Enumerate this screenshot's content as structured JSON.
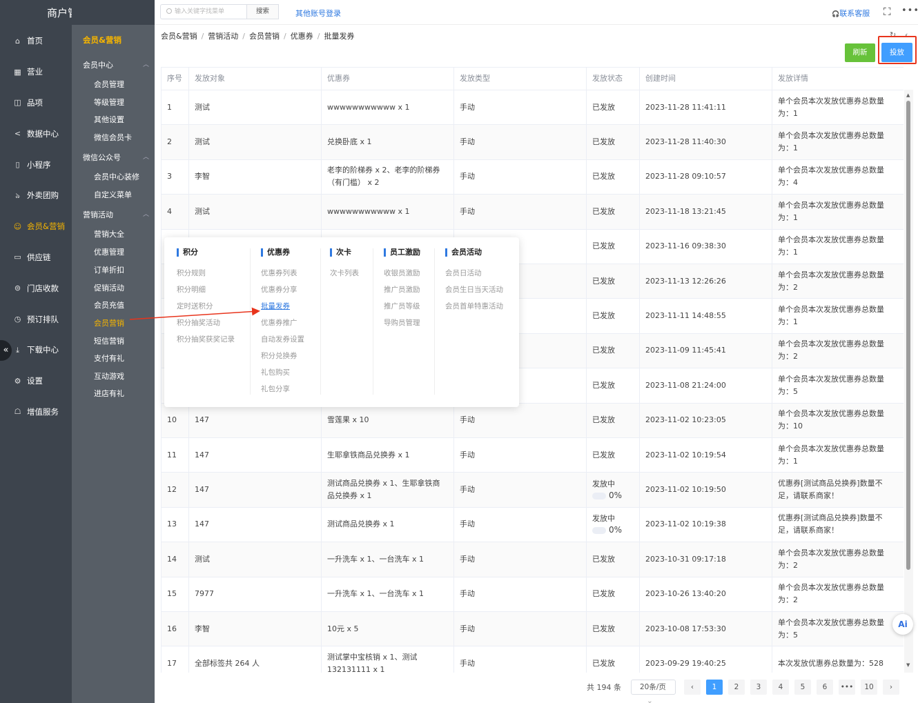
{
  "app_title": "商户管理平台",
  "main_nav": [
    {
      "label": "首页",
      "icon": "home-icon",
      "glyph": "⌂"
    },
    {
      "label": "营业",
      "icon": "calendar-icon",
      "glyph": "▦"
    },
    {
      "label": "品项",
      "icon": "bag-icon",
      "glyph": "◫"
    },
    {
      "label": "数据中心",
      "icon": "share-icon",
      "glyph": "<"
    },
    {
      "label": "小程序",
      "icon": "phone-icon",
      "glyph": "▯"
    },
    {
      "label": "外卖团购",
      "icon": "bike-icon",
      "glyph": "ঌ"
    },
    {
      "label": "会员&营销",
      "icon": "user-icon",
      "glyph": "☺",
      "active": true
    },
    {
      "label": "供应链",
      "icon": "truck-icon",
      "glyph": "▭"
    },
    {
      "label": "门店收款",
      "icon": "coin-icon",
      "glyph": "⊜"
    },
    {
      "label": "预订排队",
      "icon": "clock-icon",
      "glyph": "◷"
    },
    {
      "label": "下载中心",
      "icon": "download-icon",
      "glyph": "⤓"
    },
    {
      "label": "设置",
      "icon": "gear-icon",
      "glyph": "⚙"
    },
    {
      "label": "增值服务",
      "icon": "service-icon",
      "glyph": "☖"
    }
  ],
  "collapse_glyph": "«",
  "sub_nav": {
    "header": "会员&营销",
    "groups": [
      {
        "label": "会员中心",
        "items": [
          "会员管理",
          "等级管理",
          "其他设置",
          "微信会员卡"
        ]
      },
      {
        "label": "微信公众号",
        "items": [
          "会员中心装修",
          "自定义菜单"
        ]
      },
      {
        "label": "营销活动",
        "items": [
          "营销大全",
          "优惠管理",
          "订单折扣",
          "促销活动",
          "会员充值",
          "会员营销",
          "短信营销",
          "支付有礼",
          "互动游戏",
          "进店有礼"
        ]
      }
    ],
    "active_item": "会员营销",
    "chevron": "︿"
  },
  "topbar": {
    "search_placeholder": "输入关键字找菜单",
    "search_button": "搜索",
    "other_login": "其他账号登录",
    "contact": "联系客服",
    "contact_glyph": "🎧",
    "fullscreen_glyph": "⛶",
    "more_glyph": "•••"
  },
  "breadcrumb": [
    "会员&营销",
    "营销活动",
    "会员营销",
    "优惠券",
    "批量发券"
  ],
  "breadcrumb_sep": "/",
  "crumb_icons": {
    "refresh": "↻",
    "back": "‹"
  },
  "actions": {
    "refresh": "刷新",
    "issue": "投放"
  },
  "table": {
    "headers": [
      "序号",
      "发放对象",
      "优惠券",
      "发放类型",
      "发放状态",
      "创建时间",
      "发放详情"
    ],
    "rows": [
      {
        "no": "1",
        "target": "测试",
        "coupon": "wwwwwwwwwww x 1",
        "type": "手动",
        "status": "已发放",
        "time": "2023-11-28 11:41:11",
        "detail": "单个会员本次发放优惠券总数量为：1"
      },
      {
        "no": "2",
        "target": "测试",
        "coupon": "兑换卧底 x 1",
        "type": "手动",
        "status": "已发放",
        "time": "2023-11-28 11:40:30",
        "detail": "单个会员本次发放优惠券总数量为：1"
      },
      {
        "no": "3",
        "target": "李智",
        "coupon": "老李的阶梯券 x 2、老李的阶梯券（有门槛） x 2",
        "type": "手动",
        "status": "已发放",
        "time": "2023-11-28 09:10:57",
        "detail": "单个会员本次发放优惠券总数量为：4"
      },
      {
        "no": "4",
        "target": "测试",
        "coupon": "wwwwwwwwwww x 1",
        "type": "手动",
        "status": "已发放",
        "time": "2023-11-18 13:21:45",
        "detail": "单个会员本次发放优惠券总数量为：1"
      },
      {
        "no": "5",
        "target": "",
        "coupon": "",
        "type": "",
        "status": "已发放",
        "time": "2023-11-16 09:38:30",
        "detail": "单个会员本次发放优惠券总数量为：1"
      },
      {
        "no": "6",
        "target": "",
        "coupon": "",
        "type": "",
        "status": "已发放",
        "time": "2023-11-13 12:26:26",
        "detail": "单个会员本次发放优惠券总数量为：2"
      },
      {
        "no": "7",
        "target": "",
        "coupon": "",
        "type": "",
        "status": "已发放",
        "time": "2023-11-11 14:48:55",
        "detail": "单个会员本次发放优惠券总数量为：1"
      },
      {
        "no": "8",
        "target": "",
        "coupon": "",
        "type": "",
        "status": "已发放",
        "time": "2023-11-09 11:45:41",
        "detail": "单个会员本次发放优惠券总数量为：2"
      },
      {
        "no": "9",
        "target": "",
        "coupon": "",
        "type": "",
        "status": "已发放",
        "time": "2023-11-08 21:24:00",
        "detail": "单个会员本次发放优惠券总数量为：5"
      },
      {
        "no": "10",
        "target": "147",
        "coupon": "雪莲果 x 10",
        "type": "手动",
        "status": "已发放",
        "time": "2023-11-02 10:23:05",
        "detail": "单个会员本次发放优惠券总数量为：10"
      },
      {
        "no": "11",
        "target": "147",
        "coupon": "生耶拿铁商品兑换券 x 1",
        "type": "手动",
        "status": "已发放",
        "time": "2023-11-02 10:19:54",
        "detail": "单个会员本次发放优惠券总数量为：1"
      },
      {
        "no": "12",
        "target": "147",
        "coupon": "测试商品兑换券 x 1、生耶拿铁商品兑换券 x 1",
        "type": "手动",
        "status": "发放中",
        "progress": "0%",
        "time": "2023-11-02 10:19:50",
        "detail": "优惠券[测试商品兑换券]数量不足，请联系商家！"
      },
      {
        "no": "13",
        "target": "147",
        "coupon": "测试商品兑换券 x 1",
        "type": "手动",
        "status": "发放中",
        "progress": "0%",
        "time": "2023-11-02 10:19:38",
        "detail": "优惠券[测试商品兑换券]数量不足，请联系商家！"
      },
      {
        "no": "14",
        "target": "测试",
        "coupon": "一升洗车 x 1、一台洗车 x 1",
        "type": "手动",
        "status": "已发放",
        "time": "2023-10-31 09:17:18",
        "detail": "单个会员本次发放优惠券总数量为：2"
      },
      {
        "no": "15",
        "target": "7977",
        "coupon": "一升洗车 x 1、一台洗车 x 1",
        "type": "手动",
        "status": "已发放",
        "time": "2023-10-26 13:40:20",
        "detail": "单个会员本次发放优惠券总数量为：2"
      },
      {
        "no": "16",
        "target": "李智",
        "coupon": "10元 x 5",
        "type": "手动",
        "status": "已发放",
        "time": "2023-10-08 17:53:30",
        "detail": "单个会员本次发放优惠券总数量为：5"
      },
      {
        "no": "17",
        "target": "全部标签共 264 人",
        "coupon": "测试掌中宝核销 x 1、测试132131111 x 1",
        "type": "手动",
        "status": "已发放",
        "time": "2023-09-29 19:40:25",
        "detail": "本次发放优惠券总数量为：528"
      }
    ]
  },
  "popup": {
    "columns": [
      {
        "title": "积分",
        "links": [
          "积分规则",
          "积分明细",
          "定时送积分",
          "积分抽奖活动",
          "积分抽奖获奖记录"
        ]
      },
      {
        "title": "优惠券",
        "links": [
          "优惠券列表",
          "优惠券分享",
          "批量发券",
          "优惠券推广",
          "自动发券设置",
          "积分兑换券",
          "礼包购买",
          "礼包分享"
        ],
        "active": "批量发券"
      },
      {
        "title": "次卡",
        "links": [
          "次卡列表"
        ]
      },
      {
        "title": "员工激励",
        "links": [
          "收银员激励",
          "推广员激励",
          "推广员等级",
          "导购员管理"
        ]
      },
      {
        "title": "会员活动",
        "links": [
          "会员日活动",
          "会员生日当天活动",
          "会员首单特惠活动"
        ]
      }
    ]
  },
  "pagination": {
    "total": "共 194 条",
    "page_size": "20条/页",
    "pages": [
      "1",
      "2",
      "3",
      "4",
      "5",
      "6",
      "•••",
      "10"
    ],
    "current": "1",
    "prev": "‹",
    "next": "›",
    "select_caret": "⌄"
  },
  "ai_button": "Ai",
  "scroll_glyphs": {
    "up": "▲",
    "down": "▼"
  },
  "colors": {
    "accent": "#409eff",
    "active_nav": "#f5b400",
    "refresh_btn": "#67c23a",
    "annotation_red": "#e8341c",
    "sidebar_dark": "#3d444d",
    "sidebar_sub": "#575e66"
  }
}
